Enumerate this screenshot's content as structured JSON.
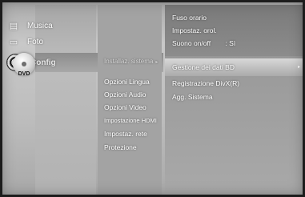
{
  "menu": {
    "categories": [
      {
        "label": "Musica",
        "icon": "music-icon"
      },
      {
        "label": "Foto",
        "icon": "photo-icon"
      },
      {
        "label": "Config",
        "icon": "gear-icon"
      }
    ],
    "disc_label": "DVD"
  },
  "submenu": {
    "active": "Installaz. sistema",
    "items": [
      "Opzioni Lingua",
      "Opzioni Audio",
      "Opzioni Video",
      "Impostazione HDMI",
      "Impostaz. rete",
      "Protezione"
    ]
  },
  "info": {
    "line1": "Fuso orario",
    "line2": "Impostaz. orol.",
    "sound_label": "Suono on/off",
    "sound_value": ": Sì"
  },
  "options": {
    "selected": "Gestione dei dati BD",
    "items": [
      "Registrazione DivX(R)",
      "Agg. Sistema"
    ]
  }
}
